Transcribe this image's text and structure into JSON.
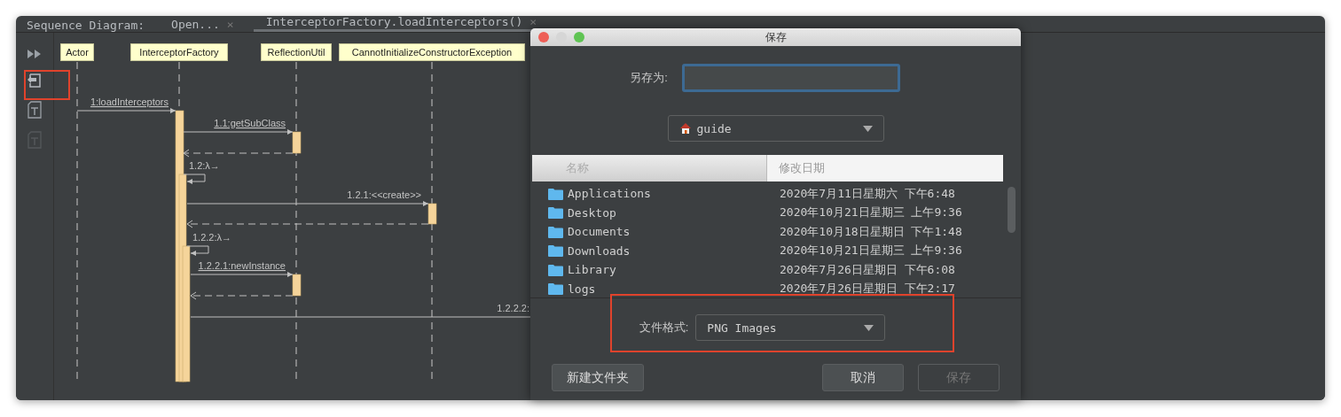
{
  "tab_bar": {
    "label": "Sequence Diagram:",
    "tabs": [
      {
        "title": "Open...",
        "close": "×",
        "selected": false
      },
      {
        "title": "InterceptorFactory.loadInterceptors()",
        "close": "×",
        "selected": true
      }
    ]
  },
  "toolbar": [
    {
      "kind": "play",
      "disabled": false
    },
    {
      "kind": "export",
      "disabled": false
    },
    {
      "kind": "text",
      "disabled": false
    },
    {
      "kind": "text",
      "disabled": true
    }
  ],
  "diagram": {
    "participants": [
      "Actor",
      "InterceptorFactory",
      "ReflectionUtil",
      "CannotInitializeConstructorException"
    ],
    "messages": [
      {
        "kind": "call",
        "label": "1:loadInterceptors",
        "underlined": true
      },
      {
        "kind": "call",
        "label": "1.1:getSubClass",
        "underlined": true
      },
      {
        "kind": "return"
      },
      {
        "kind": "self",
        "label": "1.2:λ→",
        "underlined": false
      },
      {
        "kind": "call",
        "label": "1.2.1:<<create>>",
        "underlined": false
      },
      {
        "kind": "return"
      },
      {
        "kind": "self",
        "label": "1.2.2:λ→",
        "underlined": false
      },
      {
        "kind": "call",
        "label": "1.2.2.1:newInstance",
        "underlined": true
      },
      {
        "kind": "return"
      },
      {
        "kind": "call",
        "label": "1.2.2.2:",
        "underlined": false
      }
    ]
  },
  "dialog": {
    "title": "保存",
    "save_as_label": "另存为:",
    "location": "guide",
    "columns": [
      {
        "label": "名称",
        "sorted": false
      },
      {
        "label": "修改日期",
        "sorted": true
      }
    ],
    "files": [
      {
        "name": "Applications",
        "modified": "2020年7月11日星期六  下午6:48"
      },
      {
        "name": "Desktop",
        "modified": "2020年10月21日星期三  上午9:36"
      },
      {
        "name": "Documents",
        "modified": "2020年10月18日星期日  下午1:48"
      },
      {
        "name": "Downloads",
        "modified": "2020年10月21日星期三  上午9:36"
      },
      {
        "name": "Library",
        "modified": "2020年7月26日星期日  下午6:08"
      },
      {
        "name": "logs",
        "modified": "2020年7月26日星期日  下午2:17"
      }
    ],
    "format_label": "文件格式:",
    "format": "PNG Images",
    "buttons": [
      {
        "label": "新建文件夹",
        "kind": "left",
        "disabled": false
      },
      {
        "label": "取消",
        "kind": "right",
        "disabled": false
      },
      {
        "label": "保存",
        "kind": "right",
        "disabled": true
      }
    ]
  }
}
